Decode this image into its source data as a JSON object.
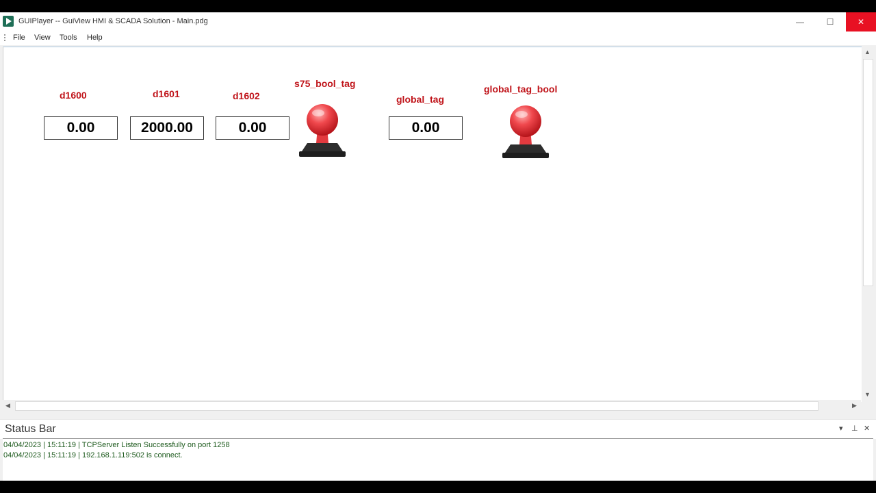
{
  "window": {
    "title": "GUIPlayer -- GuiView HMI & SCADA Solution - Main.pdg",
    "minimize_glyph": "—",
    "maximize_glyph": "☐",
    "close_glyph": "✕"
  },
  "menu": {
    "items": [
      "File",
      "View",
      "Tools",
      "Help"
    ]
  },
  "hmi": {
    "tags": [
      {
        "label": "d1600",
        "value": "0.00"
      },
      {
        "label": "d1601",
        "value": "2000.00"
      },
      {
        "label": "d1602",
        "value": "0.00"
      },
      {
        "label": "s75_bool_tag",
        "state": "off"
      },
      {
        "label": "global_tag",
        "value": "0.00"
      },
      {
        "label": "global_tag_bool",
        "state": "off"
      }
    ],
    "label_color": "#c0141a",
    "indicator_color": "#e8373c"
  },
  "scroll": {
    "up": "▲",
    "down": "▼",
    "left": "◀",
    "right": "▶"
  },
  "status_bar": {
    "title": "Status Bar",
    "controls": [
      "▾",
      "⊥",
      "✕"
    ],
    "lines": [
      "04/04/2023 | 15:11:19 | TCPServer Listen Successfully on port 1258",
      "04/04/2023 | 15:11:19 | 192.168.1.119:502 is connect."
    ]
  }
}
